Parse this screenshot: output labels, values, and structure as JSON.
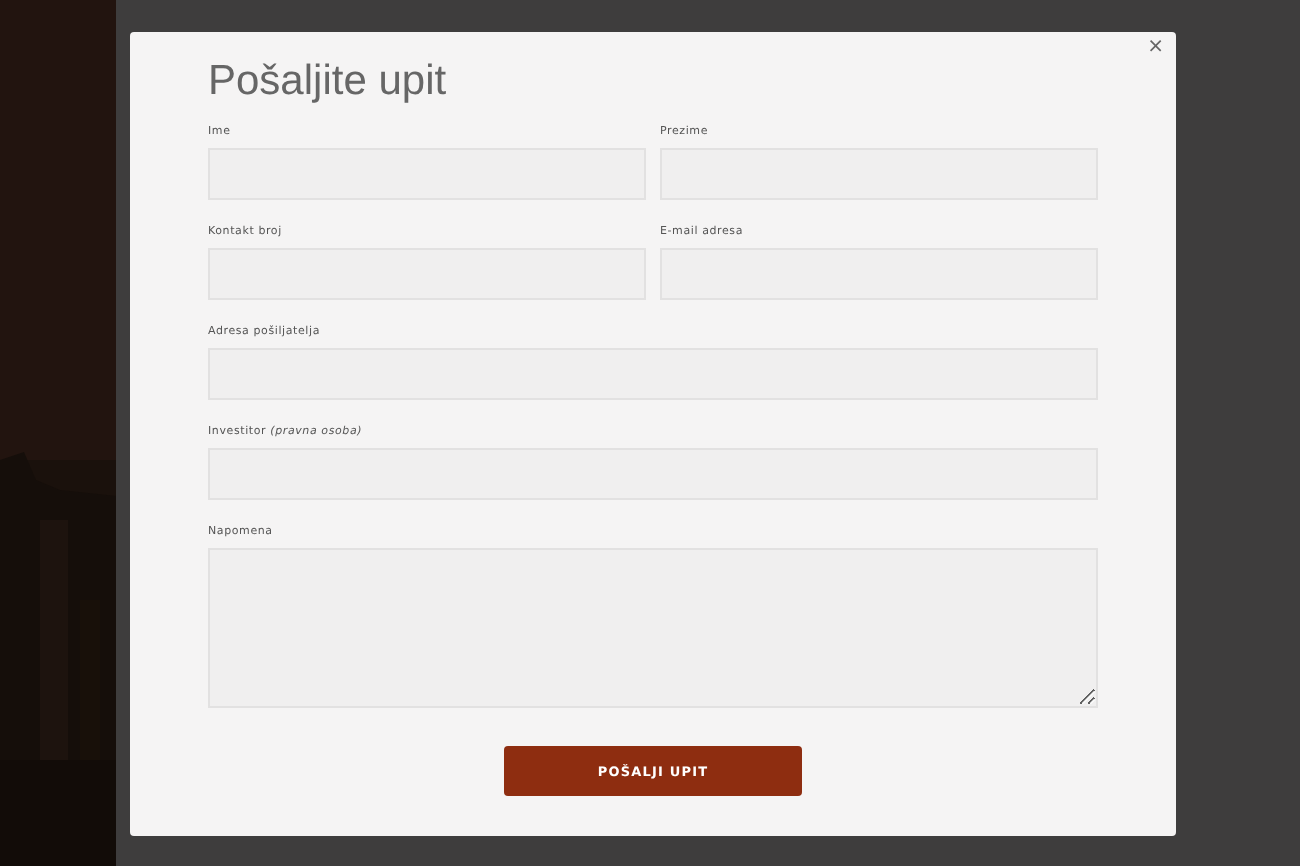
{
  "dialog": {
    "title": "Pošaljite upit",
    "close": "×",
    "fields": [
      {
        "label": "Ime",
        "kind": "text",
        "half": true
      },
      {
        "label": "Prezime",
        "kind": "text",
        "half": true
      },
      {
        "label": "Kontakt broj",
        "kind": "text",
        "half": true
      },
      {
        "label": "E-mail adresa",
        "kind": "text",
        "half": true
      },
      {
        "label": "Adresa pošiljatelja",
        "kind": "text",
        "half": false
      },
      {
        "label": "Investitor *(pravna osoba)*",
        "kind": "text",
        "half": false
      },
      {
        "label": "Napomena",
        "kind": "textarea",
        "half": false
      }
    ],
    "submit": "POŠALJI UPIT"
  }
}
